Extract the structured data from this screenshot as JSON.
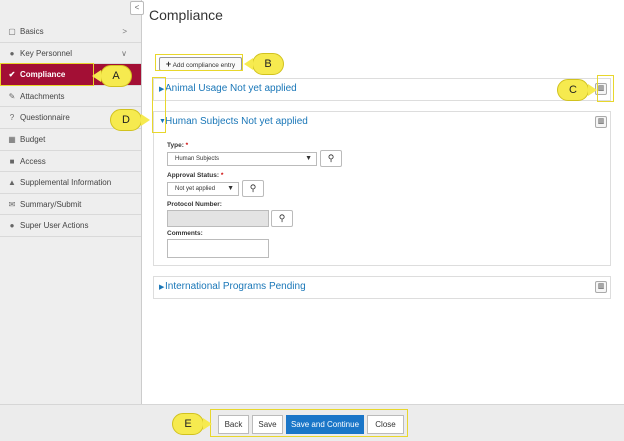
{
  "page_title": "Compliance",
  "collapse_glyph": "<",
  "sidebar": {
    "items": [
      {
        "label": "Basics",
        "icon": "document-icon",
        "glyph": "▢",
        "chevron": ">"
      },
      {
        "label": "Key Personnel",
        "icon": "user-icon",
        "glyph": "●",
        "chevron": "∨"
      },
      {
        "label": "Compliance",
        "icon": "check-icon",
        "glyph": "✔",
        "chevron": ""
      },
      {
        "label": "Attachments",
        "icon": "paperclip-icon",
        "glyph": "✎",
        "chevron": ""
      },
      {
        "label": "Questionnaire",
        "icon": "question-icon",
        "glyph": "?",
        "chevron": ""
      },
      {
        "label": "Budget",
        "icon": "calculator-icon",
        "glyph": "▦",
        "chevron": ""
      },
      {
        "label": "Access",
        "icon": "lock-icon",
        "glyph": "■",
        "chevron": ""
      },
      {
        "label": "Supplemental Information",
        "icon": "bank-icon",
        "glyph": "▲",
        "chevron": ""
      },
      {
        "label": "Summary/Submit",
        "icon": "envelope-icon",
        "glyph": "✉",
        "chevron": ""
      },
      {
        "label": "Super User Actions",
        "icon": "users-icon",
        "glyph": "●",
        "chevron": ""
      }
    ]
  },
  "add_button": {
    "plus": "+",
    "label": "Add compliance entry"
  },
  "trash_glyph": "▥",
  "panels": {
    "animal": {
      "caret": "▶",
      "title": "Animal Usage Not yet applied"
    },
    "human": {
      "caret": "▼",
      "title": "Human Subjects Not yet applied"
    },
    "international": {
      "caret": "▶",
      "title": "International Programs Pending"
    }
  },
  "form": {
    "type_label": "Type:",
    "type_value": "Human Subjects",
    "approval_label": "Approval Status:",
    "approval_value": "Not yet applied",
    "protocol_label": "Protocol Number:",
    "comments_label": "Comments:",
    "required_mark": "*",
    "dropdown_glyph": "▼",
    "search_glyph": "⚲"
  },
  "footer": {
    "back": "Back",
    "save": "Save",
    "save_continue": "Save and Continue",
    "close": "Close"
  },
  "callouts": {
    "a": "A",
    "b": "B",
    "c": "C",
    "d": "D",
    "e": "E"
  },
  "colors": {
    "active_nav": "#a30f35",
    "link_blue": "#1a77b8",
    "primary_button": "#1a76c8",
    "callout_yellow": "#f6ea4f"
  }
}
